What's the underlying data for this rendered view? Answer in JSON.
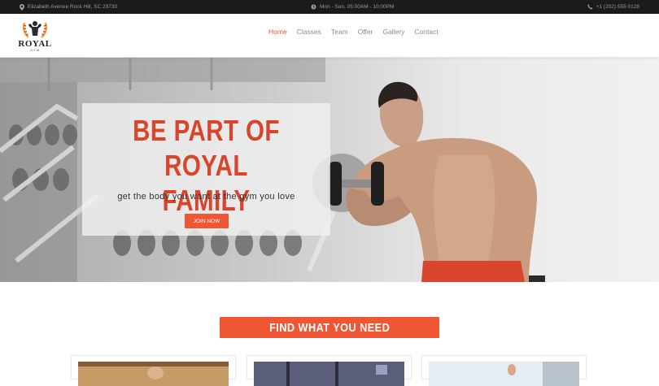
{
  "topbar": {
    "address": "Elizabeth Avenue Rock Hill, SC 29730",
    "hours": "Mon - Sun, 05:00AM - 10:00PM",
    "phone": "+1 (202) 555 0128"
  },
  "logo": {
    "word": "ROYAL",
    "sub": "GYM"
  },
  "nav": {
    "items": [
      {
        "label": "Home"
      },
      {
        "label": "Classes"
      },
      {
        "label": "Team"
      },
      {
        "label": "Offer"
      },
      {
        "label": "Gallery"
      },
      {
        "label": "Contact"
      }
    ]
  },
  "hero": {
    "title_line1": "BE PART OF ROYAL",
    "title_line2": "FAMILY",
    "subtitle": "get the body you want at the gym you love",
    "cta": "JOIN NOW"
  },
  "section": {
    "button": "FIND WHAT YOU NEED"
  },
  "colors": {
    "accent": "#ef5634",
    "title": "#d8452b",
    "topbar": "#1b1b1b"
  },
  "icons": {
    "address": "map-pin-icon",
    "hours": "clock-icon",
    "phone": "phone-icon"
  }
}
